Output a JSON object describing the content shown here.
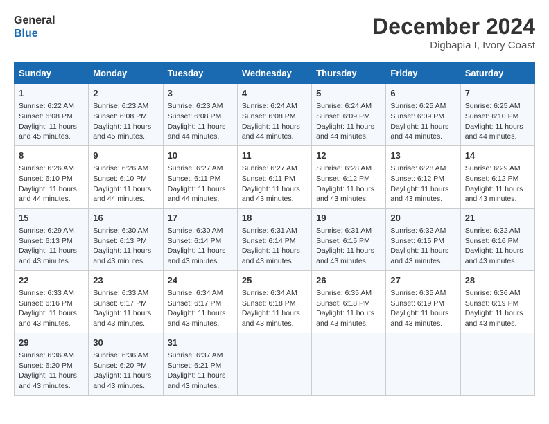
{
  "logo": {
    "general": "General",
    "blue": "Blue"
  },
  "header": {
    "month_year": "December 2024",
    "location": "Digbapia I, Ivory Coast"
  },
  "weekdays": [
    "Sunday",
    "Monday",
    "Tuesday",
    "Wednesday",
    "Thursday",
    "Friday",
    "Saturday"
  ],
  "weeks": [
    [
      {
        "day": "1",
        "sunrise": "6:22 AM",
        "sunset": "6:08 PM",
        "daylight": "11 hours and 45 minutes."
      },
      {
        "day": "2",
        "sunrise": "6:23 AM",
        "sunset": "6:08 PM",
        "daylight": "11 hours and 45 minutes."
      },
      {
        "day": "3",
        "sunrise": "6:23 AM",
        "sunset": "6:08 PM",
        "daylight": "11 hours and 44 minutes."
      },
      {
        "day": "4",
        "sunrise": "6:24 AM",
        "sunset": "6:08 PM",
        "daylight": "11 hours and 44 minutes."
      },
      {
        "day": "5",
        "sunrise": "6:24 AM",
        "sunset": "6:09 PM",
        "daylight": "11 hours and 44 minutes."
      },
      {
        "day": "6",
        "sunrise": "6:25 AM",
        "sunset": "6:09 PM",
        "daylight": "11 hours and 44 minutes."
      },
      {
        "day": "7",
        "sunrise": "6:25 AM",
        "sunset": "6:10 PM",
        "daylight": "11 hours and 44 minutes."
      }
    ],
    [
      {
        "day": "8",
        "sunrise": "6:26 AM",
        "sunset": "6:10 PM",
        "daylight": "11 hours and 44 minutes."
      },
      {
        "day": "9",
        "sunrise": "6:26 AM",
        "sunset": "6:10 PM",
        "daylight": "11 hours and 44 minutes."
      },
      {
        "day": "10",
        "sunrise": "6:27 AM",
        "sunset": "6:11 PM",
        "daylight": "11 hours and 44 minutes."
      },
      {
        "day": "11",
        "sunrise": "6:27 AM",
        "sunset": "6:11 PM",
        "daylight": "11 hours and 43 minutes."
      },
      {
        "day": "12",
        "sunrise": "6:28 AM",
        "sunset": "6:12 PM",
        "daylight": "11 hours and 43 minutes."
      },
      {
        "day": "13",
        "sunrise": "6:28 AM",
        "sunset": "6:12 PM",
        "daylight": "11 hours and 43 minutes."
      },
      {
        "day": "14",
        "sunrise": "6:29 AM",
        "sunset": "6:12 PM",
        "daylight": "11 hours and 43 minutes."
      }
    ],
    [
      {
        "day": "15",
        "sunrise": "6:29 AM",
        "sunset": "6:13 PM",
        "daylight": "11 hours and 43 minutes."
      },
      {
        "day": "16",
        "sunrise": "6:30 AM",
        "sunset": "6:13 PM",
        "daylight": "11 hours and 43 minutes."
      },
      {
        "day": "17",
        "sunrise": "6:30 AM",
        "sunset": "6:14 PM",
        "daylight": "11 hours and 43 minutes."
      },
      {
        "day": "18",
        "sunrise": "6:31 AM",
        "sunset": "6:14 PM",
        "daylight": "11 hours and 43 minutes."
      },
      {
        "day": "19",
        "sunrise": "6:31 AM",
        "sunset": "6:15 PM",
        "daylight": "11 hours and 43 minutes."
      },
      {
        "day": "20",
        "sunrise": "6:32 AM",
        "sunset": "6:15 PM",
        "daylight": "11 hours and 43 minutes."
      },
      {
        "day": "21",
        "sunrise": "6:32 AM",
        "sunset": "6:16 PM",
        "daylight": "11 hours and 43 minutes."
      }
    ],
    [
      {
        "day": "22",
        "sunrise": "6:33 AM",
        "sunset": "6:16 PM",
        "daylight": "11 hours and 43 minutes."
      },
      {
        "day": "23",
        "sunrise": "6:33 AM",
        "sunset": "6:17 PM",
        "daylight": "11 hours and 43 minutes."
      },
      {
        "day": "24",
        "sunrise": "6:34 AM",
        "sunset": "6:17 PM",
        "daylight": "11 hours and 43 minutes."
      },
      {
        "day": "25",
        "sunrise": "6:34 AM",
        "sunset": "6:18 PM",
        "daylight": "11 hours and 43 minutes."
      },
      {
        "day": "26",
        "sunrise": "6:35 AM",
        "sunset": "6:18 PM",
        "daylight": "11 hours and 43 minutes."
      },
      {
        "day": "27",
        "sunrise": "6:35 AM",
        "sunset": "6:19 PM",
        "daylight": "11 hours and 43 minutes."
      },
      {
        "day": "28",
        "sunrise": "6:36 AM",
        "sunset": "6:19 PM",
        "daylight": "11 hours and 43 minutes."
      }
    ],
    [
      {
        "day": "29",
        "sunrise": "6:36 AM",
        "sunset": "6:20 PM",
        "daylight": "11 hours and 43 minutes."
      },
      {
        "day": "30",
        "sunrise": "6:36 AM",
        "sunset": "6:20 PM",
        "daylight": "11 hours and 43 minutes."
      },
      {
        "day": "31",
        "sunrise": "6:37 AM",
        "sunset": "6:21 PM",
        "daylight": "11 hours and 43 minutes."
      },
      null,
      null,
      null,
      null
    ]
  ]
}
